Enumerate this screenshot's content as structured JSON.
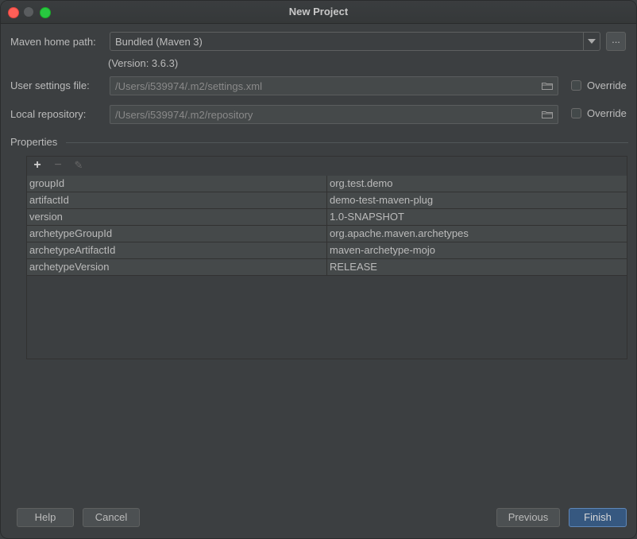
{
  "window": {
    "title": "New Project"
  },
  "maven": {
    "home_label": "Maven home path:",
    "home_value": "Bundled (Maven 3)",
    "browse_label": "...",
    "version_text": "(Version: 3.6.3)"
  },
  "user_settings": {
    "label": "User settings file:",
    "value": "/Users/i539974/.m2/settings.xml",
    "override_label": "Override"
  },
  "local_repo": {
    "label": "Local repository:",
    "value": "/Users/i539974/.m2/repository",
    "override_label": "Override"
  },
  "properties": {
    "title": "Properties",
    "toolbar": {
      "add": "+",
      "remove": "−",
      "edit": "✎"
    },
    "rows": [
      {
        "key": "groupId",
        "value": "org.test.demo"
      },
      {
        "key": "artifactId",
        "value": "demo-test-maven-plug"
      },
      {
        "key": "version",
        "value": "1.0-SNAPSHOT"
      },
      {
        "key": "archetypeGroupId",
        "value": "org.apache.maven.archetypes"
      },
      {
        "key": "archetypeArtifactId",
        "value": "maven-archetype-mojo"
      },
      {
        "key": "archetypeVersion",
        "value": "RELEASE"
      }
    ]
  },
  "footer": {
    "help": "Help",
    "cancel": "Cancel",
    "previous": "Previous",
    "finish": "Finish"
  },
  "colors": {
    "background": "#3c3f41",
    "primary_button": "#365880",
    "traffic_close": "#fe5f57",
    "traffic_max": "#28c840"
  }
}
